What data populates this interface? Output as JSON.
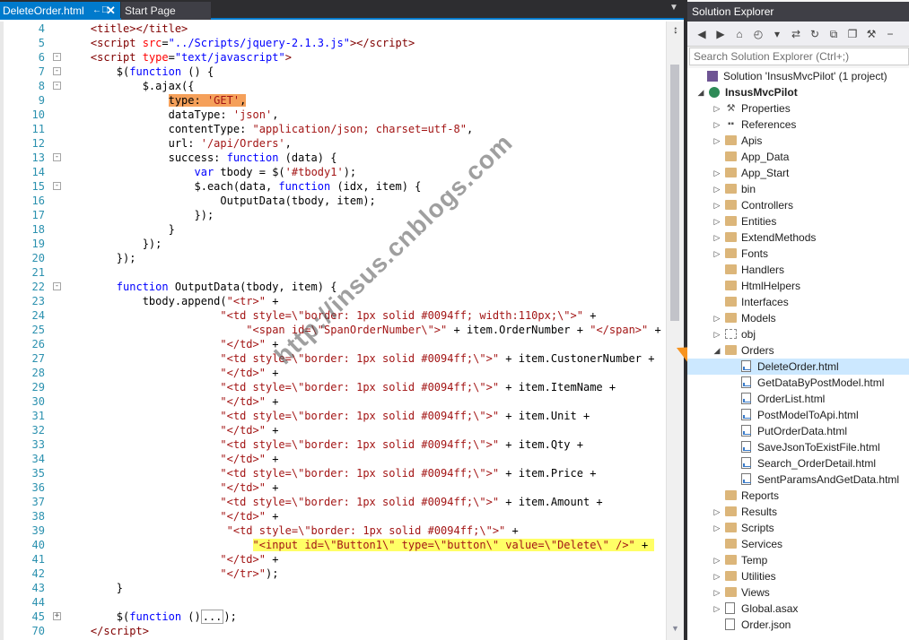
{
  "tabs": {
    "active": "DeleteOrder.html",
    "pin_glyph": "←⃥",
    "close_glyph": "✕",
    "second": "Start Page",
    "dropdown_glyph": "▼"
  },
  "editor": {
    "lines": [
      {
        "n": "4",
        "html": "    <span class=\"tagc\">&lt;title&gt;&lt;/title&gt;</span>"
      },
      {
        "n": "5",
        "html": "    <span class=\"tagc\">&lt;script</span> <span class=\"attr\">src</span>=<span class=\"kw\">\"../Scripts/jquery-2.1.3.js\"</span><span class=\"tagc\">&gt;&lt;/script&gt;</span>"
      },
      {
        "n": "6",
        "fold": "-",
        "html": "    <span class=\"tagc\">&lt;script</span> <span class=\"attr\">type</span>=<span class=\"kw\">\"text/javascript\"</span><span class=\"tagc\">&gt;</span>"
      },
      {
        "n": "7",
        "fold": "-",
        "html": "        $(<span class=\"kw\">function</span> () {"
      },
      {
        "n": "8",
        "fold": "-",
        "html": "            $.ajax({"
      },
      {
        "n": "9",
        "html": "                <span class=\"hl-orange\">type: <span class=\"str\">'GET'</span>,</span>"
      },
      {
        "n": "10",
        "html": "                dataType: <span class=\"str\">'json'</span>,"
      },
      {
        "n": "11",
        "html": "                contentType: <span class=\"str\">\"application/json; charset=utf-8\"</span>,"
      },
      {
        "n": "12",
        "html": "                url: <span class=\"str\">'/api/Orders'</span>,"
      },
      {
        "n": "13",
        "fold": "-",
        "html": "                success: <span class=\"kw\">function</span> (data) {"
      },
      {
        "n": "14",
        "html": "                    <span class=\"kw\">var</span> tbody = $(<span class=\"str\">'#tbody1'</span>);"
      },
      {
        "n": "15",
        "fold": "-",
        "html": "                    $.each(data, <span class=\"kw\">function</span> (idx, item) {"
      },
      {
        "n": "16",
        "html": "                        OutputData(tbody, item);"
      },
      {
        "n": "17",
        "html": "                    });"
      },
      {
        "n": "18",
        "html": "                }"
      },
      {
        "n": "19",
        "html": "            });"
      },
      {
        "n": "20",
        "html": "        });"
      },
      {
        "n": "21",
        "html": ""
      },
      {
        "n": "22",
        "fold": "-",
        "html": "        <span class=\"kw\">function</span> OutputData(tbody, item) {"
      },
      {
        "n": "23",
        "html": "            tbody.append(<span class=\"str\">\"&lt;tr&gt;\"</span> +"
      },
      {
        "n": "24",
        "html": "                        <span class=\"str\">\"&lt;td style=\\\"border: 1px solid #0094ff; width:110px;\\\"&gt;\"</span> +"
      },
      {
        "n": "25",
        "html": "                            <span class=\"str\">\"&lt;span id=\\\"SpanOrderNumber\\\"&gt;\"</span> + item.OrderNumber + <span class=\"str\">\"&lt;/span&gt;\"</span> +"
      },
      {
        "n": "26",
        "html": "                        <span class=\"str\">\"&lt;/td&gt;\"</span> +"
      },
      {
        "n": "27",
        "html": "                        <span class=\"str\">\"&lt;td style=\\\"border: 1px solid #0094ff;\\\"&gt;\"</span> + item.CustonerNumber +"
      },
      {
        "n": "28",
        "html": "                        <span class=\"str\">\"&lt;/td&gt;\"</span> +"
      },
      {
        "n": "29",
        "html": "                        <span class=\"str\">\"&lt;td style=\\\"border: 1px solid #0094ff;\\\"&gt;\"</span> + item.ItemName +"
      },
      {
        "n": "30",
        "html": "                        <span class=\"str\">\"&lt;/td&gt;\"</span> +"
      },
      {
        "n": "31",
        "html": "                        <span class=\"str\">\"&lt;td style=\\\"border: 1px solid #0094ff;\\\"&gt;\"</span> + item.Unit +"
      },
      {
        "n": "32",
        "html": "                        <span class=\"str\">\"&lt;/td&gt;\"</span> +"
      },
      {
        "n": "33",
        "html": "                        <span class=\"str\">\"&lt;td style=\\\"border: 1px solid #0094ff;\\\"&gt;\"</span> + item.Qty +"
      },
      {
        "n": "34",
        "html": "                        <span class=\"str\">\"&lt;/td&gt;\"</span> +"
      },
      {
        "n": "35",
        "html": "                        <span class=\"str\">\"&lt;td style=\\\"border: 1px solid #0094ff;\\\"&gt;\"</span> + item.Price +"
      },
      {
        "n": "36",
        "html": "                        <span class=\"str\">\"&lt;/td&gt;\"</span> +"
      },
      {
        "n": "37",
        "html": "                        <span class=\"str\">\"&lt;td style=\\\"border: 1px solid #0094ff;\\\"&gt;\"</span> + item.Amount +"
      },
      {
        "n": "38",
        "html": "                        <span class=\"str\">\"&lt;/td&gt;\"</span> +"
      },
      {
        "n": "39",
        "html": "                         <span class=\"str\">\"&lt;td style=\\\"border: 1px solid #0094ff;\\\"&gt;\"</span> +"
      },
      {
        "n": "40",
        "html": "                             <span class=\"hl-yellow\"><span class=\"str\">\"&lt;input id=\\\"Button1\\\" type=\\\"button\\\" value=\\\"Delete\\\" /&gt;\"</span> + </span>"
      },
      {
        "n": "41",
        "html": "                        <span class=\"str\">\"&lt;/td&gt;\"</span> +"
      },
      {
        "n": "42",
        "html": "                        <span class=\"str\">\"&lt;/tr&gt;\"</span>);"
      },
      {
        "n": "43",
        "html": "        }"
      },
      {
        "n": "44",
        "html": ""
      },
      {
        "n": "45",
        "fold": "+",
        "html": "        $(<span class=\"kw\">function</span> ()<span class=\"collapsed-box\">...</span>);"
      },
      {
        "n": "70",
        "html": "    <span class=\"tagc\">&lt;/script&gt;</span>"
      }
    ],
    "watermark": "http://insus.cnblogs.com",
    "split_glyph": "↕",
    "scroll_down_glyph": "▼"
  },
  "solution_explorer": {
    "title": "Solution Explorer",
    "search_placeholder": "Search Solution Explorer (Ctrl+;)",
    "toolbar_icons": [
      {
        "name": "back-icon",
        "glyph": "◀"
      },
      {
        "name": "forward-icon",
        "glyph": "▶"
      },
      {
        "name": "home-icon",
        "glyph": "⌂"
      },
      {
        "name": "history-icon",
        "glyph": "◴"
      },
      {
        "name": "dropdown-icon",
        "glyph": "▾"
      },
      {
        "name": "sync-icon",
        "glyph": "⇄"
      },
      {
        "name": "refresh-icon",
        "glyph": "↻"
      },
      {
        "name": "collapse-all-icon",
        "glyph": "⧉"
      },
      {
        "name": "show-all-files-icon",
        "glyph": "❐"
      },
      {
        "name": "properties-icon",
        "glyph": "⚒"
      },
      {
        "name": "preview-icon",
        "glyph": "−"
      }
    ],
    "nodes": [
      {
        "label": "Solution 'InsusMvcPilot' (1 project)",
        "indent": 0,
        "icon": "solution",
        "expander": ""
      },
      {
        "label": "InsusMvcPilot",
        "indent": 1,
        "icon": "globe",
        "expander": "◢",
        "bold": true
      },
      {
        "label": "Properties",
        "indent": 2,
        "icon": "wrench",
        "expander": "▷"
      },
      {
        "label": "References",
        "indent": 2,
        "icon": "refs",
        "expander": "▷"
      },
      {
        "label": "Apis",
        "indent": 2,
        "icon": "folder",
        "expander": "▷"
      },
      {
        "label": "App_Data",
        "indent": 2,
        "icon": "folder",
        "expander": ""
      },
      {
        "label": "App_Start",
        "indent": 2,
        "icon": "folder",
        "expander": "▷"
      },
      {
        "label": "bin",
        "indent": 2,
        "icon": "folder",
        "expander": "▷"
      },
      {
        "label": "Controllers",
        "indent": 2,
        "icon": "folder",
        "expander": "▷"
      },
      {
        "label": "Entities",
        "indent": 2,
        "icon": "folder",
        "expander": "▷"
      },
      {
        "label": "ExtendMethods",
        "indent": 2,
        "icon": "folder",
        "expander": "▷"
      },
      {
        "label": "Fonts",
        "indent": 2,
        "icon": "folder",
        "expander": "▷"
      },
      {
        "label": "Handlers",
        "indent": 2,
        "icon": "folder",
        "expander": ""
      },
      {
        "label": "HtmlHelpers",
        "indent": 2,
        "icon": "folder",
        "expander": ""
      },
      {
        "label": "Interfaces",
        "indent": 2,
        "icon": "folder",
        "expander": ""
      },
      {
        "label": "Models",
        "indent": 2,
        "icon": "folder",
        "expander": "▷"
      },
      {
        "label": "obj",
        "indent": 2,
        "icon": "obj",
        "expander": "▷"
      },
      {
        "label": "Orders",
        "indent": 2,
        "icon": "folder-open",
        "expander": "◢"
      },
      {
        "label": "DeleteOrder.html",
        "indent": 3,
        "icon": "html",
        "expander": "",
        "selected": true
      },
      {
        "label": "GetDataByPostModel.html",
        "indent": 3,
        "icon": "html",
        "expander": ""
      },
      {
        "label": "OrderList.html",
        "indent": 3,
        "icon": "html",
        "expander": ""
      },
      {
        "label": "PostModelToApi.html",
        "indent": 3,
        "icon": "html",
        "expander": ""
      },
      {
        "label": "PutOrderData.html",
        "indent": 3,
        "icon": "html",
        "expander": ""
      },
      {
        "label": "SaveJsonToExistFile.html",
        "indent": 3,
        "icon": "html",
        "expander": ""
      },
      {
        "label": "Search_OrderDetail.html",
        "indent": 3,
        "icon": "html",
        "expander": ""
      },
      {
        "label": "SentParamsAndGetData.html",
        "indent": 3,
        "icon": "html",
        "expander": ""
      },
      {
        "label": "Reports",
        "indent": 2,
        "icon": "folder",
        "expander": ""
      },
      {
        "label": "Results",
        "indent": 2,
        "icon": "folder",
        "expander": "▷"
      },
      {
        "label": "Scripts",
        "indent": 2,
        "icon": "folder",
        "expander": "▷"
      },
      {
        "label": "Services",
        "indent": 2,
        "icon": "folder",
        "expander": ""
      },
      {
        "label": "Temp",
        "indent": 2,
        "icon": "folder",
        "expander": "▷"
      },
      {
        "label": "Utilities",
        "indent": 2,
        "icon": "folder",
        "expander": "▷"
      },
      {
        "label": "Views",
        "indent": 2,
        "icon": "folder",
        "expander": "▷"
      },
      {
        "label": "Global.asax",
        "indent": 2,
        "icon": "file",
        "expander": "▷"
      },
      {
        "label": "Order.json",
        "indent": 2,
        "icon": "file",
        "expander": ""
      }
    ]
  },
  "colors": {
    "accent": "#007acc",
    "arrow": "#f7931e",
    "selection": "#cce8ff",
    "highlight_orange": "#f5a05a",
    "highlight_yellow": "#ffff66"
  }
}
